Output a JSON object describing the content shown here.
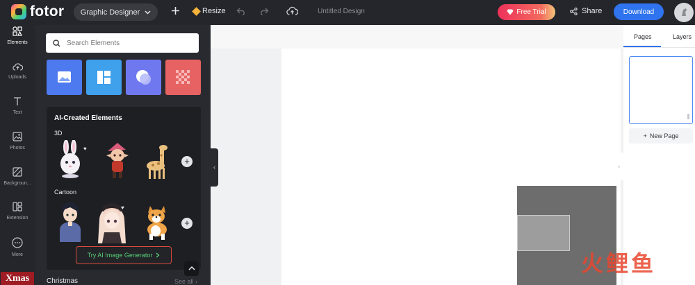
{
  "topbar": {
    "logo_text": "fotor",
    "designer_select": "Graphic Designer",
    "resize_label": "Resize",
    "design_title": "Untitled Design",
    "free_trial_label": "Free Trial",
    "share_label": "Share",
    "download_label": "Download"
  },
  "rail": {
    "items": [
      {
        "label": "Elements",
        "icon": "elements-icon"
      },
      {
        "label": "Uploads",
        "icon": "upload-icon"
      },
      {
        "label": "Text",
        "icon": "text-icon"
      },
      {
        "label": "Photos",
        "icon": "photos-icon"
      },
      {
        "label": "Backgroun...",
        "icon": "background-icon"
      },
      {
        "label": "Extension",
        "icon": "extension-icon"
      },
      {
        "label": "More",
        "icon": "more-icon"
      }
    ],
    "xmas_badge": "Xmas"
  },
  "panel": {
    "search_placeholder": "Search Elements",
    "ai_section": {
      "title": "AI-Created Elements",
      "group_3d": "3D",
      "group_cartoon": "Cartoon",
      "cta": "Try AI Image Generator"
    },
    "christmas_label": "Christmas",
    "see_all_label": "See all"
  },
  "right_panel": {
    "tabs": [
      "Pages",
      "Layers"
    ],
    "new_page_label": "New Page"
  },
  "watermark_text": "火鲤鱼",
  "colors": {
    "accent": "#2f73ee",
    "dark_bg": "#25262b",
    "panel_bg": "#292a2f",
    "cta_border": "#d84a3c",
    "cta_text": "#55d077"
  }
}
